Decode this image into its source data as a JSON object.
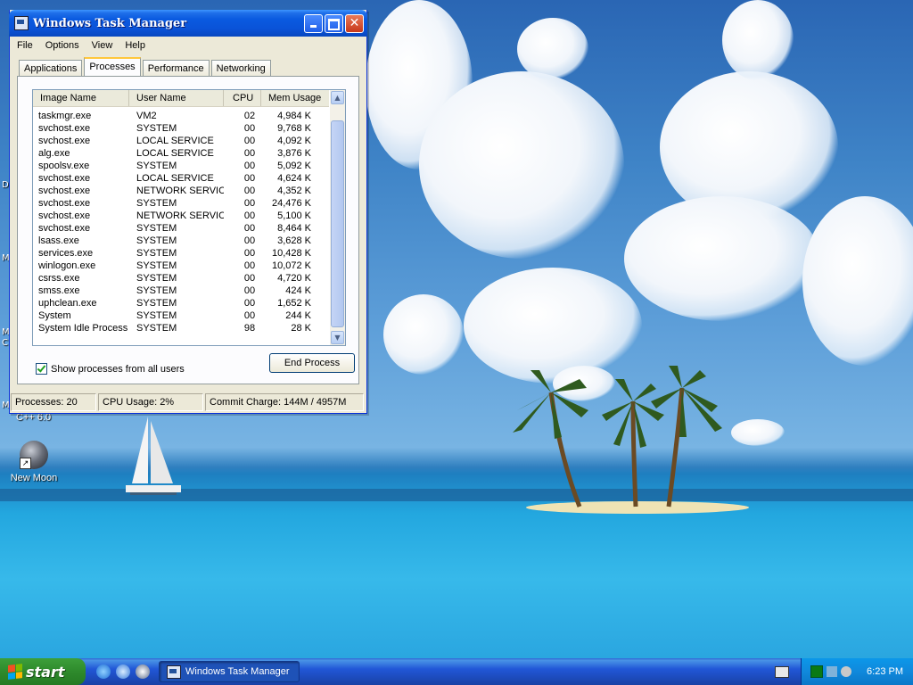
{
  "desktop": {
    "icons": [
      {
        "label": "New Moon"
      }
    ],
    "partial_label": "C++ 6.0",
    "edge_fragments": [
      "D",
      "M",
      "M",
      "C",
      "M"
    ]
  },
  "window": {
    "title": "Windows Task Manager",
    "menu": [
      "File",
      "Options",
      "View",
      "Help"
    ],
    "tabs": [
      {
        "label": "Applications",
        "active": false
      },
      {
        "label": "Processes",
        "active": true
      },
      {
        "label": "Performance",
        "active": false
      },
      {
        "label": "Networking",
        "active": false
      }
    ],
    "columns": [
      "Image Name",
      "User Name",
      "CPU",
      "Mem Usage"
    ],
    "processes": [
      {
        "name": "taskmgr.exe",
        "user": "VM2",
        "cpu": "02",
        "mem": "4,984 K"
      },
      {
        "name": "svchost.exe",
        "user": "SYSTEM",
        "cpu": "00",
        "mem": "9,768 K"
      },
      {
        "name": "svchost.exe",
        "user": "LOCAL SERVICE",
        "cpu": "00",
        "mem": "4,092 K"
      },
      {
        "name": "alg.exe",
        "user": "LOCAL SERVICE",
        "cpu": "00",
        "mem": "3,876 K"
      },
      {
        "name": "spoolsv.exe",
        "user": "SYSTEM",
        "cpu": "00",
        "mem": "5,092 K"
      },
      {
        "name": "svchost.exe",
        "user": "LOCAL SERVICE",
        "cpu": "00",
        "mem": "4,624 K"
      },
      {
        "name": "svchost.exe",
        "user": "NETWORK SERVICE",
        "cpu": "00",
        "mem": "4,352 K"
      },
      {
        "name": "svchost.exe",
        "user": "SYSTEM",
        "cpu": "00",
        "mem": "24,476 K"
      },
      {
        "name": "svchost.exe",
        "user": "NETWORK SERVICE",
        "cpu": "00",
        "mem": "5,100 K"
      },
      {
        "name": "svchost.exe",
        "user": "SYSTEM",
        "cpu": "00",
        "mem": "8,464 K"
      },
      {
        "name": "lsass.exe",
        "user": "SYSTEM",
        "cpu": "00",
        "mem": "3,628 K"
      },
      {
        "name": "services.exe",
        "user": "SYSTEM",
        "cpu": "00",
        "mem": "10,428 K"
      },
      {
        "name": "winlogon.exe",
        "user": "SYSTEM",
        "cpu": "00",
        "mem": "10,072 K"
      },
      {
        "name": "csrss.exe",
        "user": "SYSTEM",
        "cpu": "00",
        "mem": "4,720 K"
      },
      {
        "name": "smss.exe",
        "user": "SYSTEM",
        "cpu": "00",
        "mem": "424 K"
      },
      {
        "name": "uphclean.exe",
        "user": "SYSTEM",
        "cpu": "00",
        "mem": "1,652 K"
      },
      {
        "name": "System",
        "user": "SYSTEM",
        "cpu": "00",
        "mem": "244 K"
      },
      {
        "name": "System Idle Process",
        "user": "SYSTEM",
        "cpu": "98",
        "mem": "28 K"
      }
    ],
    "show_all_label": "Show processes from all users",
    "show_all_checked": true,
    "end_process_label": "End Process",
    "status": {
      "processes": "Processes: 20",
      "cpu": "CPU Usage: 2%",
      "commit": "Commit Charge: 144M / 4957M"
    }
  },
  "taskbar": {
    "start_label": "start",
    "task_button": "Windows Task Manager",
    "clock": "6:23 PM",
    "colors": {
      "start": "#2e8a2c",
      "taskbar": "#2157d7",
      "tray": "#1089dc"
    }
  }
}
